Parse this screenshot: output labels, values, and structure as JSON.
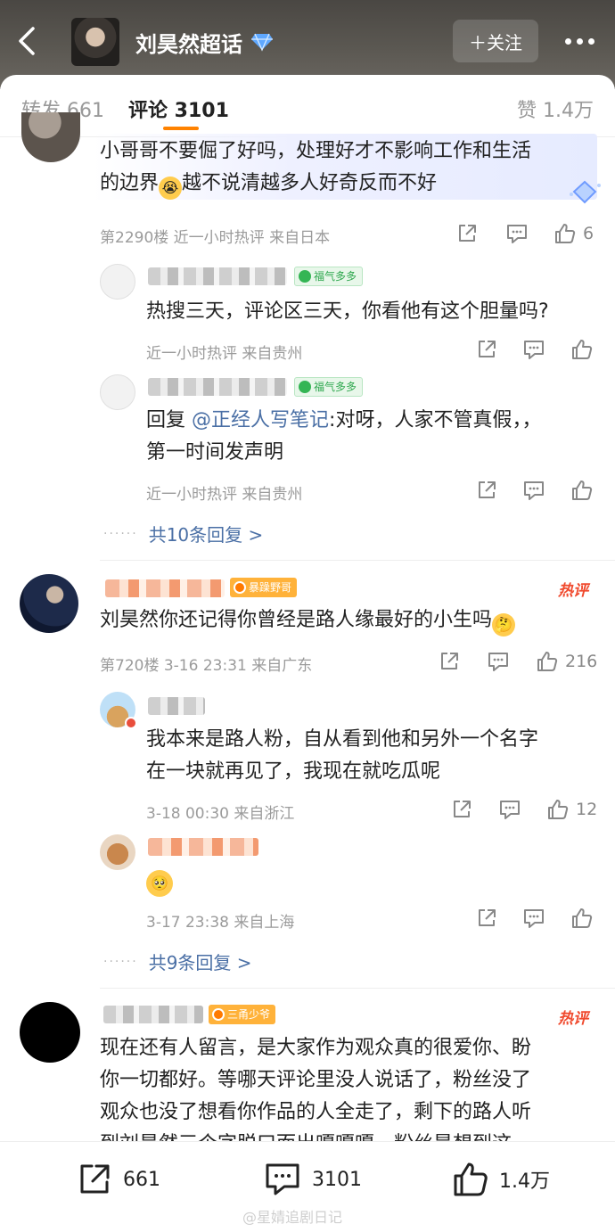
{
  "header": {
    "title": "刘昊然超话",
    "follow_label": "＋关注"
  },
  "tabs": {
    "repost": "转发 661",
    "comments": "评论 3101",
    "likes": "赞 1.4万"
  },
  "comments": [
    {
      "text_line1": "小哥哥不要倔了好吗，处理好才不影响工作和生活",
      "text_line2a": "的边界",
      "text_line2b": "越不说清越多人好奇反而不好",
      "meta": "第2290楼  近一小时热评  来自日本",
      "likes": "6",
      "replies": [
        {
          "badge": "福气多多",
          "text": "热搜三天，评论区三天，你看他有这个胆量吗?",
          "meta": "近一小时热评  来自贵州"
        },
        {
          "badge": "福气多多",
          "reply_prefix": "回复",
          "mention": "@正经人写笔记",
          "text_rest": ":对呀，人家不管真假，，",
          "text_line2": "第一时间发声明",
          "meta": "近一小时热评  来自贵州"
        }
      ],
      "more_replies": "共10条回复 >"
    },
    {
      "badge": "暴躁野哥",
      "hot": "热评",
      "text": "刘昊然你还记得你曾经是路人缘最好的小生吗",
      "meta": "第720楼  3-16 23:31  来自广东",
      "likes": "216",
      "replies": [
        {
          "text_line1": "我本来是路人粉，自从看到他和另外一个名字",
          "text_line2": "在一块就再见了，我现在就吃瓜呢",
          "meta": "3-18 00:30  来自浙江",
          "likes": "12"
        },
        {
          "meta": "3-17 23:38  来自上海"
        }
      ],
      "more_replies": "共9条回复 >"
    },
    {
      "badge": "三甬少爷",
      "hot": "热评",
      "line1": "现在还有人留言，是大家作为观众真的很爱你、盼",
      "line2": "你一切都好。等哪天评论里没人说话了，粉丝没了",
      "line3": "观众也没了想看你作品的人全走了，剩下的路人听",
      "line4": "到刘昊然三个字脱口而出嘎嘎嘎，粉丝是想到这一"
    }
  ],
  "bottom": {
    "reposts": "661",
    "comments": "3101",
    "likes": "1.4万"
  },
  "watermark": "@星婧追剧日记",
  "colors": {
    "accent": "#ff8200",
    "link": "#4a6fa5",
    "hot": "#f04a2e"
  }
}
